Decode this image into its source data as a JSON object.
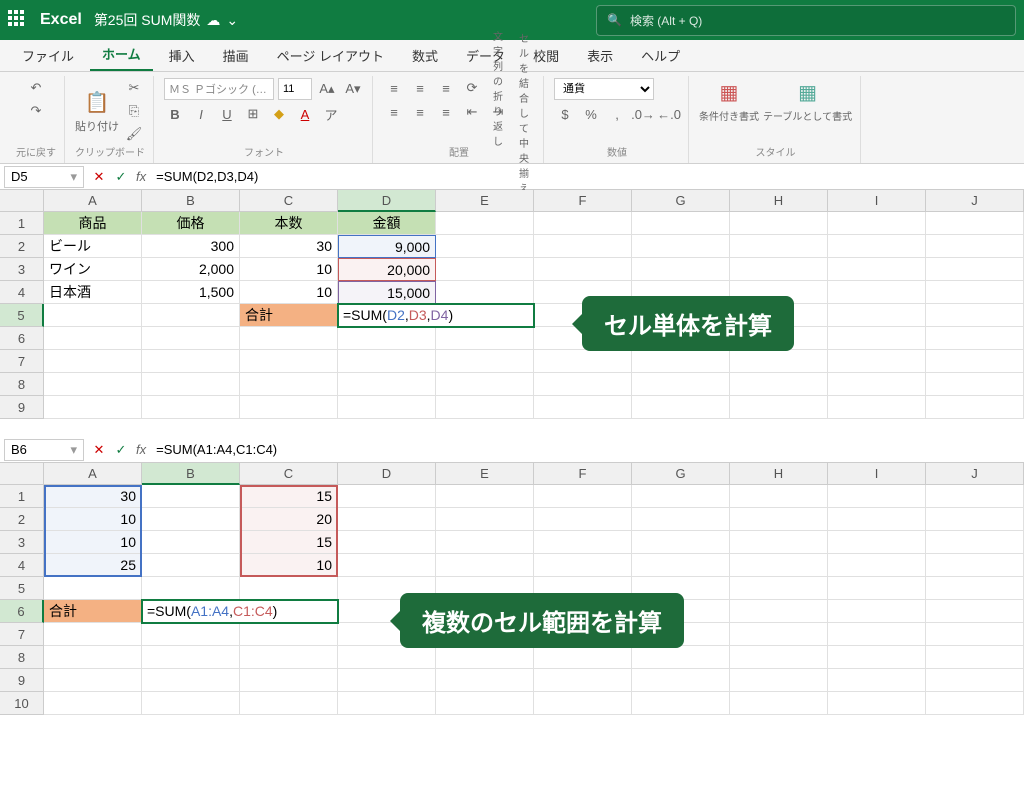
{
  "title_bar": {
    "app_name": "Excel",
    "doc_name": "第25回 SUM関数",
    "search_placeholder": "検索 (Alt + Q)"
  },
  "tabs": {
    "file": "ファイル",
    "home": "ホーム",
    "insert": "挿入",
    "draw": "描画",
    "page_layout": "ページ レイアウト",
    "formulas": "数式",
    "data": "データ",
    "review": "校閲",
    "view": "表示",
    "help": "ヘルプ"
  },
  "ribbon": {
    "undo_group": "元に戻す",
    "clipboard_group": "クリップボード",
    "paste": "貼り付け",
    "font_group": "フォント",
    "font_name": "ＭＳ Ｐゴシック (…",
    "font_size": "11",
    "alignment_group": "配置",
    "wrap_text": "文字列の折り返し",
    "merge_center": "セルを結合して中央揃え",
    "number_group": "数値",
    "currency": "通貨",
    "cond_format": "条件付き書式",
    "table_format": "テーブルとして書式",
    "styles_group": "スタイル"
  },
  "sheet1": {
    "name_box": "D5",
    "formula": "=SUM(D2,D3,D4)",
    "cols": [
      "A",
      "B",
      "C",
      "D",
      "E",
      "F",
      "G",
      "H",
      "I",
      "J"
    ],
    "headers": {
      "a": "商品",
      "b": "価格",
      "c": "本数",
      "d": "金額"
    },
    "rows": [
      {
        "a": "ビール",
        "b": "300",
        "c": "30",
        "d": "9,000"
      },
      {
        "a": "ワイン",
        "b": "2,000",
        "c": "10",
        "d": "20,000"
      },
      {
        "a": "日本酒",
        "b": "1,500",
        "c": "10",
        "d": "15,000"
      }
    ],
    "total_label": "合計",
    "edit_prefix": "=SUM(",
    "edit_ref1": "D2",
    "edit_ref2": "D3",
    "edit_ref3": "D4",
    "callout": "セル単体を計算"
  },
  "sheet2": {
    "name_box": "B6",
    "formula": "=SUM(A1:A4,C1:C4)",
    "cols": [
      "A",
      "B",
      "C",
      "D",
      "E",
      "F",
      "G",
      "H",
      "I",
      "J"
    ],
    "colA": [
      "30",
      "10",
      "10",
      "25"
    ],
    "colC": [
      "15",
      "20",
      "15",
      "10"
    ],
    "total_label": "合計",
    "edit_prefix": "=SUM(",
    "edit_ref1": "A1:A4",
    "edit_ref2": "C1:C4",
    "callout": "複数のセル範囲を計算"
  }
}
